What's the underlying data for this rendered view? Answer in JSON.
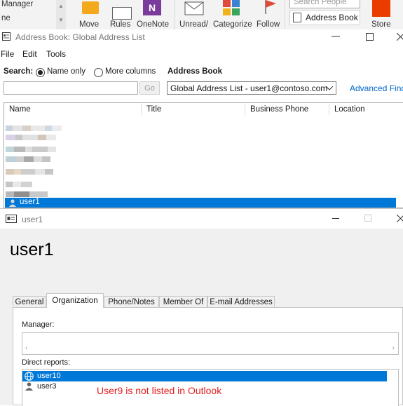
{
  "ribbon": {
    "left_items": [
      "Manager",
      "ne"
    ],
    "buttons": [
      "Move",
      "Rules",
      "OneNote",
      "Unread/",
      "Categorize",
      "Follow"
    ],
    "search_people_placeholder": "Search People",
    "address_book_label": "Address Book",
    "store_label": "Store",
    "colors": {
      "move": "#f3a91b",
      "onenote": "#7a3b9c",
      "follow": "#e04a3a",
      "store": "#eb3c00"
    }
  },
  "address_book_window": {
    "title": "Address Book: Global Address List",
    "menu": [
      "File",
      "Edit",
      "Tools"
    ],
    "search_label": "Search:",
    "radio_name_only": "Name only",
    "radio_more_columns": "More columns",
    "address_book_label": "Address Book",
    "search_value": "",
    "go_label": "Go",
    "address_book_selected": "Global Address List - user1@contoso.com",
    "advanced_find": "Advanced Find",
    "columns": [
      "Name",
      "Title",
      "Business Phone",
      "Location"
    ],
    "selected_row": {
      "name": "user1"
    }
  },
  "properties_window": {
    "title": "user1",
    "heading": "user1",
    "tabs": [
      "General",
      "Organization",
      "Phone/Notes",
      "Member Of",
      "E-mail Addresses"
    ],
    "active_tab": "Organization",
    "manager_label": "Manager:",
    "manager_value": "",
    "direct_reports_label": "Direct reports:",
    "direct_reports": [
      "user10",
      "user3"
    ],
    "annotation": "User9 is not listed in Outlook",
    "accent_color": "#0078d7",
    "annotation_color": "#e02020"
  }
}
